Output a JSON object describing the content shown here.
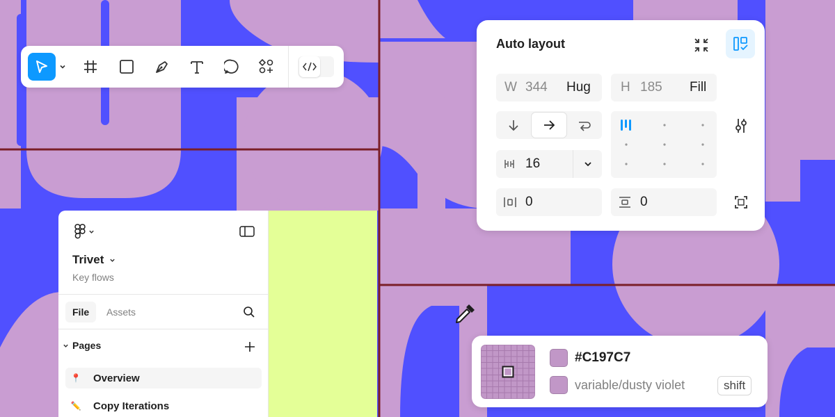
{
  "colors": {
    "background_violet": "#C99DD2",
    "background_blue": "#5050FF",
    "lime": "#E4FF97",
    "grid_line": "#7A1F28",
    "accent_blue": "#0D99FF",
    "sampled": "#C197C7"
  },
  "toolbar": {
    "tools": [
      {
        "icon": "move-pointer-icon",
        "active": true
      },
      {
        "icon": "frame-icon"
      },
      {
        "icon": "rectangle-icon"
      },
      {
        "icon": "pen-icon"
      },
      {
        "icon": "text-icon"
      },
      {
        "icon": "comment-icon"
      },
      {
        "icon": "resources-icon"
      }
    ],
    "dev_mode_icon": "code-brackets-icon"
  },
  "auto_layout": {
    "title": "Auto layout",
    "width": {
      "label": "W",
      "value": "344",
      "mode": "Hug"
    },
    "height": {
      "label": "H",
      "value": "185",
      "mode": "Fill"
    },
    "direction_icons": [
      "arrow-down-icon",
      "arrow-right-icon",
      "wrap-icon"
    ],
    "gap": "16",
    "horizontal_padding": "0",
    "vertical_padding": "0"
  },
  "file_panel": {
    "project": "Trivet",
    "subtitle": "Key flows",
    "tabs": [
      "File",
      "Assets"
    ],
    "pages_header": "Pages",
    "pages": [
      {
        "icon": "📍",
        "name": "Overview"
      },
      {
        "icon": "✏️",
        "name": "Copy Iterations"
      }
    ]
  },
  "color_picker": {
    "hex": "#C197C7",
    "variable": "variable/dusty violet",
    "shortcut": "shift"
  }
}
